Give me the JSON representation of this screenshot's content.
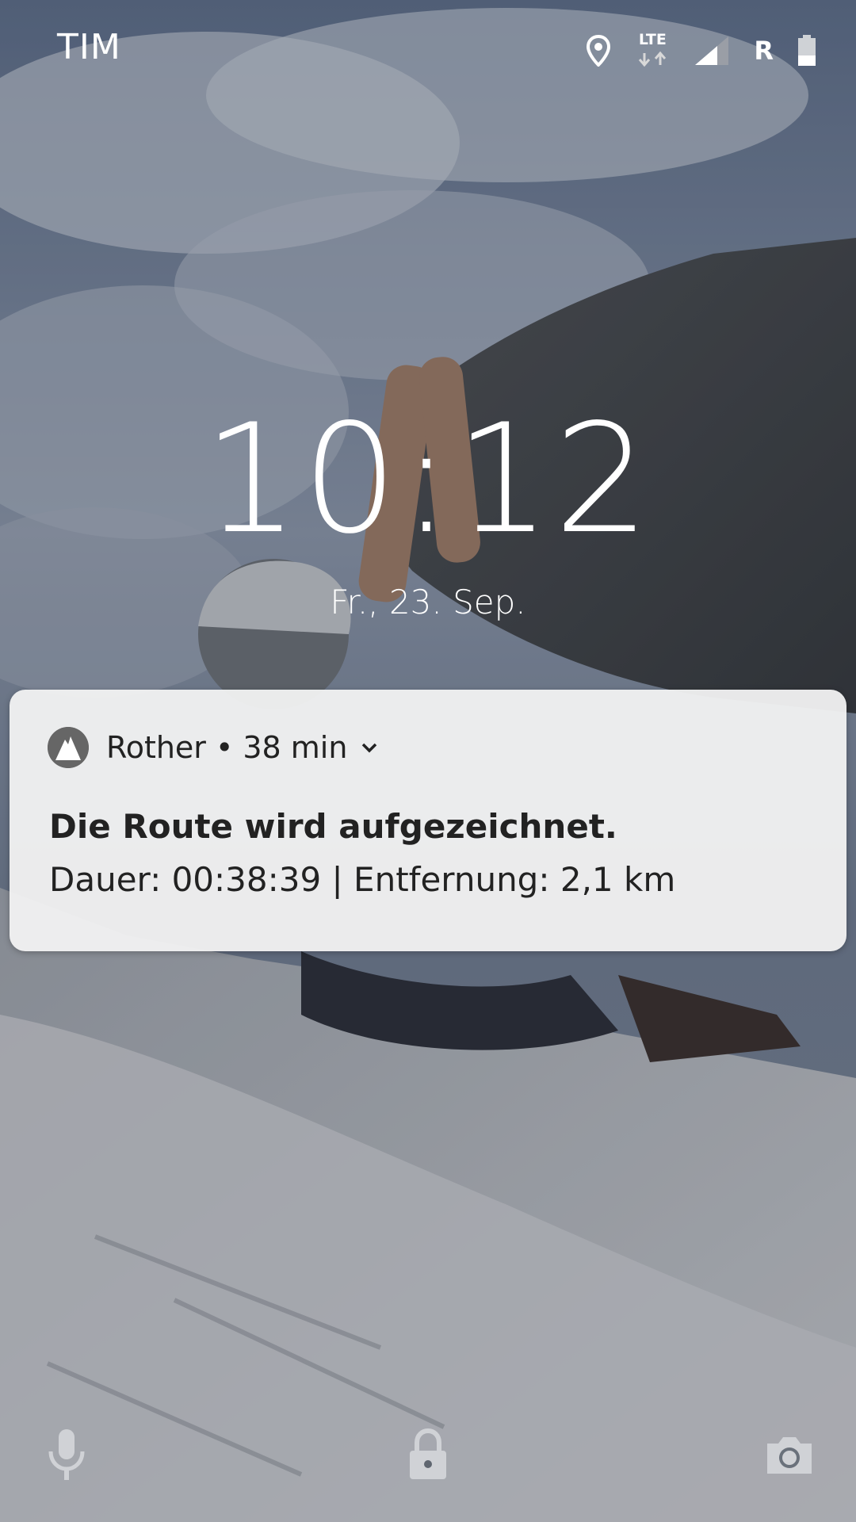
{
  "status_bar": {
    "carrier": "TIM",
    "network_type": "LTE",
    "roaming_indicator": "R",
    "icons": [
      "location-icon",
      "lte-data-icon",
      "signal-strength-icon",
      "roaming-icon",
      "battery-icon"
    ]
  },
  "lock_screen": {
    "time": "10:12",
    "date": "Fr., 23. Sep."
  },
  "notification": {
    "app_name": "Rother",
    "separator": "•",
    "elapsed": "38 min",
    "title": "Die Route wird aufgezeichnet.",
    "text": "Dauer: 00:38:39 | Entfernung: 2,1 km",
    "icon": "rother-mountain-icon",
    "expand_icon": "chevron-down-icon"
  },
  "shortcuts": {
    "left": "microphone-icon",
    "center": "lock-icon",
    "right": "camera-icon"
  },
  "colors": {
    "notification_background": "#f2f2f2",
    "text_primary": "#222222",
    "app_icon_background": "#666666",
    "status_text": "#ffffff"
  }
}
